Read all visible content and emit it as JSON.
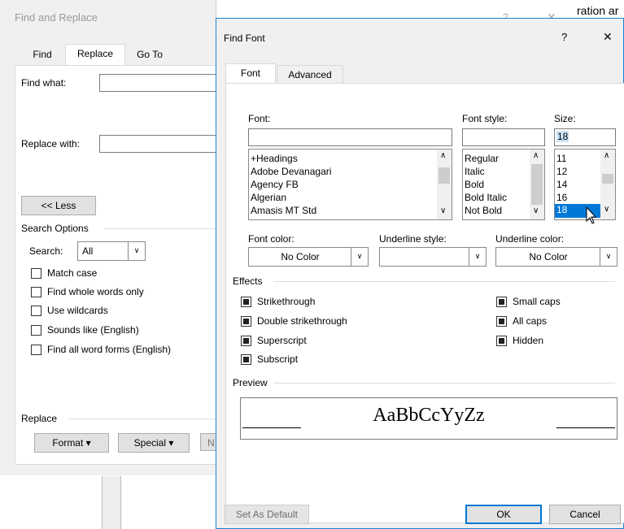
{
  "background_text": "ration ar",
  "find_replace": {
    "title": "Find and Replace",
    "help": "?",
    "close": "✕",
    "tabs": [
      "Find",
      "Replace",
      "Go To"
    ],
    "find_what_label": "Find what:",
    "replace_with_label": "Replace with:",
    "less_button": "<< Less",
    "search_options_label": "Search Options",
    "search_label": "Search:",
    "search_value": "All",
    "options": [
      "Match case",
      "Find whole words only",
      "Use wildcards",
      "Sounds like (English)",
      "Find all word forms (English)"
    ],
    "replace_label": "Replace",
    "format_button": "Format ▾",
    "special_button": "Special ▾",
    "no_formatting_partial": "N"
  },
  "find_font": {
    "title": "Find Font",
    "help": "?",
    "close": "✕",
    "tabs": [
      "Font",
      "Advanced"
    ],
    "font_label": "Font:",
    "font_style_label": "Font style:",
    "size_label": "Size:",
    "size_value": "18",
    "fonts": [
      "+Headings",
      "Adobe Devanagari",
      "Agency FB",
      "Algerian",
      "Amasis MT Std"
    ],
    "styles": [
      "Regular",
      "Italic",
      "Bold",
      "Bold Italic",
      "Not Bold"
    ],
    "sizes": [
      "11",
      "12",
      "14",
      "16",
      "18"
    ],
    "selected_size": "18",
    "font_color_label": "Font color:",
    "font_color_value": "No Color",
    "underline_style_label": "Underline style:",
    "underline_style_value": "",
    "underline_color_label": "Underline color:",
    "underline_color_value": "No Color",
    "effects_label": "Effects",
    "effects_left": [
      "Strikethrough",
      "Double strikethrough",
      "Superscript",
      "Subscript"
    ],
    "effects_right": [
      "Small caps",
      "All caps",
      "Hidden"
    ],
    "preview_label": "Preview",
    "preview_text": "AaBbCcYyZz",
    "set_default_button": "Set As Default",
    "ok_button": "OK",
    "cancel_button": "Cancel"
  }
}
